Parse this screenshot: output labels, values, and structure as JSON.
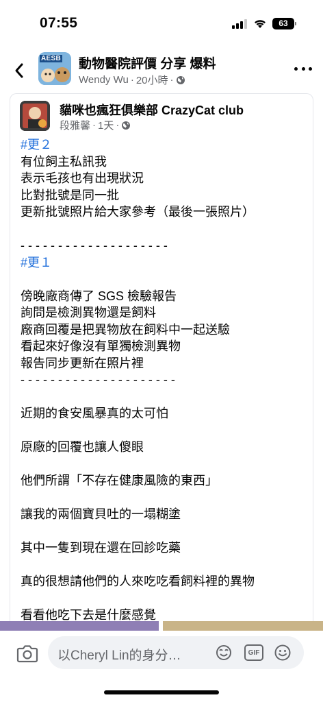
{
  "status_bar": {
    "time": "07:55",
    "battery": "63"
  },
  "header": {
    "group_badge": "AESB",
    "group_name": "動物醫院評價 分享 爆料",
    "poster": "Wendy Wu",
    "separator": "·",
    "time_ago": "20小時"
  },
  "post": {
    "author": "貓咪也瘋狂俱樂部 CrazyCat club",
    "meta_name": "段雅馨",
    "separator": "·",
    "meta_time": "1天",
    "lines": [
      {
        "text": "#更２",
        "type": "hashtag"
      },
      {
        "text": "有位飼主私訊我",
        "type": "text"
      },
      {
        "text": "表示毛孩也有出現狀況",
        "type": "text"
      },
      {
        "text": "比對批號是同一批",
        "type": "text"
      },
      {
        "text": "更新批號照片給大家參考（最後一張照片）",
        "type": "text"
      },
      {
        "text": "",
        "type": "blank"
      },
      {
        "text": "- - - - - - - - - - - - - - - - - - - -",
        "type": "text"
      },
      {
        "text": "#更１",
        "type": "hashtag"
      },
      {
        "text": "",
        "type": "blank"
      },
      {
        "text": "傍晚廠商傳了 SGS 檢驗報告",
        "type": "text"
      },
      {
        "text": "詢問是檢測異物還是飼料",
        "type": "text"
      },
      {
        "text": "廠商回覆是把異物放在飼料中一起送驗",
        "type": "text"
      },
      {
        "text": "看起來好像沒有單獨檢測異物",
        "type": "text"
      },
      {
        "text": "報告同步更新在照片裡",
        "type": "text"
      },
      {
        "text": "- - - - - - - - - - - - - - - - - - - - -",
        "type": "text"
      },
      {
        "text": "",
        "type": "blank"
      },
      {
        "text": "近期的食安風暴真的太可怕",
        "type": "text"
      },
      {
        "text": "",
        "type": "blank"
      },
      {
        "text": "原廠的回覆也讓人傻眼",
        "type": "text"
      },
      {
        "text": "",
        "type": "blank"
      },
      {
        "text": "他們所謂「不存在健康風險的東西」",
        "type": "text"
      },
      {
        "text": "",
        "type": "blank"
      },
      {
        "text": "讓我的兩個寶貝吐的一塌糊塗",
        "type": "text"
      },
      {
        "text": "",
        "type": "blank"
      },
      {
        "text": "其中一隻到現在還在回診吃藥",
        "type": "text"
      },
      {
        "text": "",
        "type": "blank"
      },
      {
        "text": "真的很想請他們的人來吃吃看飼料裡的異物",
        "type": "text"
      },
      {
        "text": "",
        "type": "blank"
      },
      {
        "text": "看看他吃下去是什麼感覺",
        "type": "text"
      }
    ]
  },
  "comment_bar": {
    "placeholder": "以Cheryl Lin的身分…",
    "gif_label": "GIF"
  },
  "colors": {
    "hashtag": "#216fdb",
    "meta": "#65676b",
    "input_bg": "#f0f2f5"
  }
}
